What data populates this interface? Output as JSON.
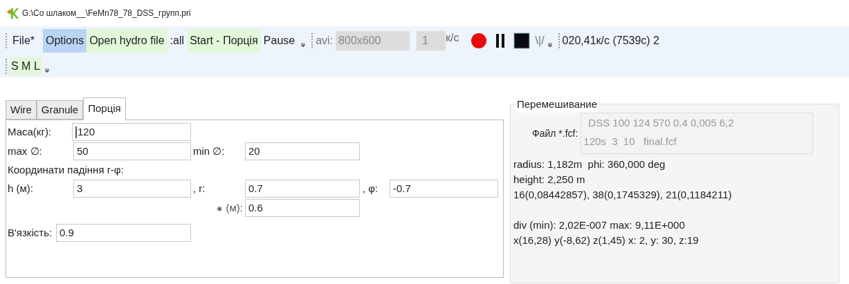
{
  "window": {
    "title": "G:\\Со шлаком__\\FeMn78_78_DSS_групп.pri"
  },
  "toolbar": {
    "items": [
      {
        "label": "File*",
        "kind": "plain"
      },
      {
        "label": "Options",
        "kind": "blue"
      },
      {
        "label": "Open hydro file",
        "kind": "green"
      },
      {
        "label": ":all",
        "kind": "plain"
      },
      {
        "label": "Start - Порція",
        "kind": "green"
      },
      {
        "label": "Pause",
        "kind": "plain"
      }
    ],
    "avi_label": "avi:",
    "resolution": "800x600",
    "fps": "1",
    "fps_unit": "к/с",
    "record_glyph": "\\|/",
    "status": "020,41к/с (7539с) 2"
  },
  "toolbar2": {
    "items": [
      {
        "label": "S M L",
        "kind": "green"
      }
    ]
  },
  "tabs": [
    {
      "label": "Wire",
      "selected": false
    },
    {
      "label": "Granule",
      "selected": false
    },
    {
      "label": "Порція",
      "selected": true
    }
  ],
  "form": {
    "mass_label": "Маса(кг):",
    "mass": "120",
    "max_label": "max ∅:",
    "max": "50",
    "min_label": "min ∅:",
    "min": "20",
    "coords_label": "Координати падіння r-φ:",
    "h_label": "h (м):",
    "h": "3",
    "r_label": ", r:",
    "r": "0.7",
    "phi_label": ", φ:",
    "phi": "-0.7",
    "star_label": "⁕ (м):",
    "star": "0.6",
    "visc_label": "В'язкість:",
    "visc": "0.9"
  },
  "mixing": {
    "title": "Перемешивание",
    "file_label": "Файл *.fcf:",
    "file_lines": [
      "DSS 100 124 570 0.4 0,005 6,2",
      "120s  3  10   final.fcf"
    ],
    "lines": [
      "radius: 1,182m  phi: 360,000 deg",
      "height: 2,250 m",
      "16(0,08442857), 38(0,1745329), 21(0,1184211)"
    ],
    "lines2": [
      "div (min): 2,02E-007 max: 9,11E+000",
      "x(16,28) y(-8,62) z(1,45) x: 2, y: 30, z:19"
    ]
  }
}
